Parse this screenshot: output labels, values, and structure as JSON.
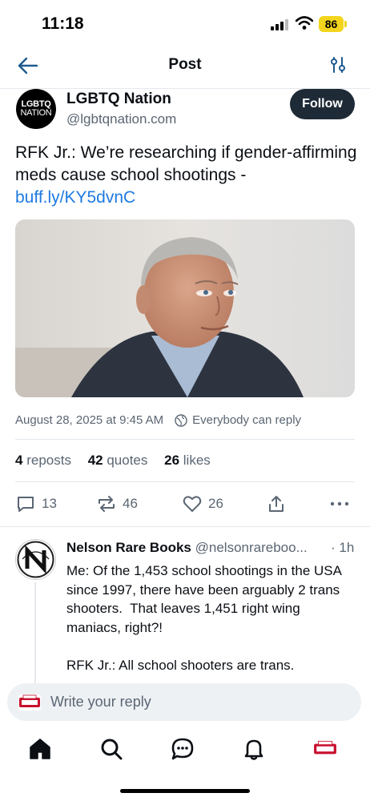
{
  "status": {
    "time": "11:18",
    "battery": "86"
  },
  "header": {
    "title": "Post"
  },
  "author": {
    "avatar_text_1": "LGBTQ",
    "avatar_text_2": "NATION",
    "name": "LGBTQ Nation",
    "handle": "@lgbtqnation.com",
    "follow_label": "Follow"
  },
  "post": {
    "text": "RFK Jr.: We’re researching if gender-affirming meds cause school shootings - ",
    "link": "buff.ly/KY5dvnC",
    "date": "August 28, 2025 at 9:45 AM",
    "reply_setting": "Everybody can reply"
  },
  "stats": {
    "reposts_count": "4",
    "reposts_label": "reposts",
    "quotes_count": "42",
    "quotes_label": "quotes",
    "likes_count": "26",
    "likes_label": "likes"
  },
  "actions": {
    "replies": "13",
    "reposts": "46",
    "likes": "26"
  },
  "reply": {
    "name": "Nelson Rare Books",
    "handle": "@nelsonrareboo...",
    "time": "· 1h",
    "text": "Me: Of the 1,453 school shootings in the USA since 1997, there have been arguably 2 trans shooters.  That leaves 1,451 right wing maniacs, right?!\n\nRFK Jr.: All school shooters are trans."
  },
  "composer": {
    "placeholder": "Write your reply"
  },
  "colors": {
    "link": "#1f7ae0",
    "follow_bg": "#1e2a36",
    "battery": "#f4d51e",
    "muted": "#5a6673"
  },
  "icons": [
    "back-arrow-icon",
    "filter-icon",
    "globe-icon",
    "reply-icon",
    "repost-icon",
    "heart-icon",
    "share-icon",
    "more-icon",
    "home-icon",
    "search-icon",
    "chat-icon",
    "bell-icon"
  ]
}
